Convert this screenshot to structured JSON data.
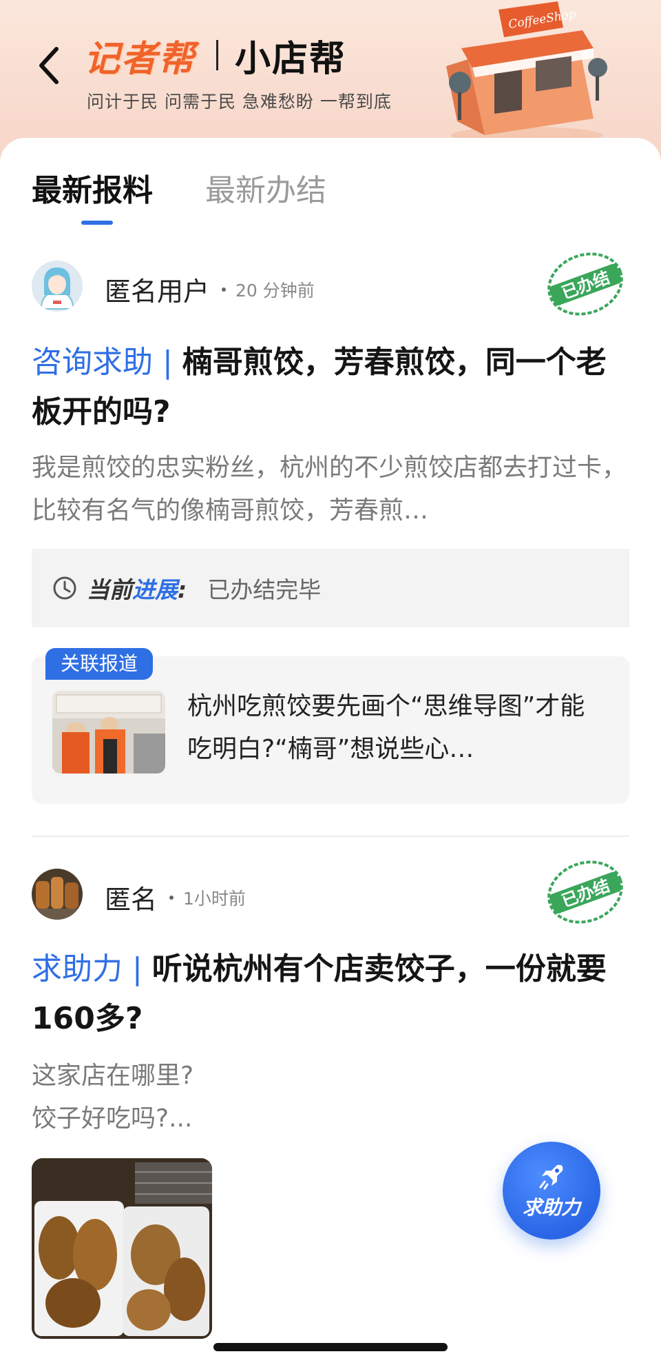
{
  "header": {
    "back_icon": "chevron-left-icon",
    "brand_main": "记者帮",
    "brand_sub": "小店帮",
    "slogan": "问计于民 问需于民  急难愁盼  一帮到底",
    "shop_sign": "CoffeeShop",
    "shop_sign_color": "#ffffff",
    "accent_orange": "#f0632a"
  },
  "tabs": [
    {
      "label": "最新报料",
      "active": true
    },
    {
      "label": "最新办结",
      "active": false
    }
  ],
  "posts": [
    {
      "user": "匿名用户",
      "time": "20 分钟前",
      "stamp": "已办结",
      "category": "咨询求助 | ",
      "title": "楠哥煎饺，芳春煎饺，同一个老板开的吗?",
      "body": "我是煎饺的忠实粉丝，杭州的不少煎饺店都去打过卡，比较有名气的像楠哥煎饺，芳春煎…",
      "progress_label_a": "当前",
      "progress_label_b": "进展",
      "progress_colon": ":",
      "progress_value": "已办结完毕",
      "related_tag": "关联报道",
      "related_text": "杭州吃煎饺要先画个“思维导图”才能吃明白?“楠哥”想说些心…"
    },
    {
      "user": "匿名",
      "time": "1小时前",
      "stamp": "已办结",
      "category": "求助力 | ",
      "title": "听说杭州有个店卖饺子，一份就要160多?",
      "body_line1": "这家店在哪里?",
      "body_line2": "饺子好吃吗?..."
    }
  ],
  "fab": {
    "label": "求助力",
    "icon": "rocket-icon",
    "color": "#2f6fe4"
  },
  "colors": {
    "accent_blue": "#2f6fe4",
    "stamp_green": "#3aa65a"
  }
}
